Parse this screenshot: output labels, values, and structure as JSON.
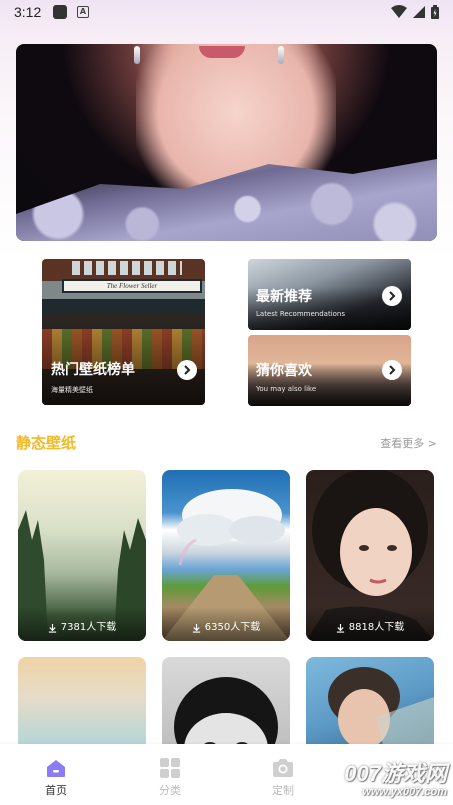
{
  "status_bar": {
    "time": "3:12"
  },
  "features": {
    "hot": {
      "title": "热门壁纸榜单",
      "subtitle": "海量精美壁纸",
      "shop_sign": "The Flower Seller"
    },
    "new": {
      "title": "最新推荐",
      "subtitle": "Latest Recommendations"
    },
    "guess": {
      "title": "猜你喜欢",
      "subtitle": "You may also like"
    }
  },
  "section": {
    "title": "静态壁纸",
    "more": "查看更多 >"
  },
  "wallpapers": [
    {
      "downloads": "7381人下载"
    },
    {
      "downloads": "6350人下载"
    },
    {
      "downloads": "8818人下载"
    }
  ],
  "nav": {
    "home": "首页",
    "category": "分类",
    "custom": "定制"
  },
  "watermark": {
    "big": "007游戏网",
    "small": "www.yx007.com"
  },
  "colors": {
    "accent": "#f2b928",
    "nav_active": "#8b7cf6"
  }
}
